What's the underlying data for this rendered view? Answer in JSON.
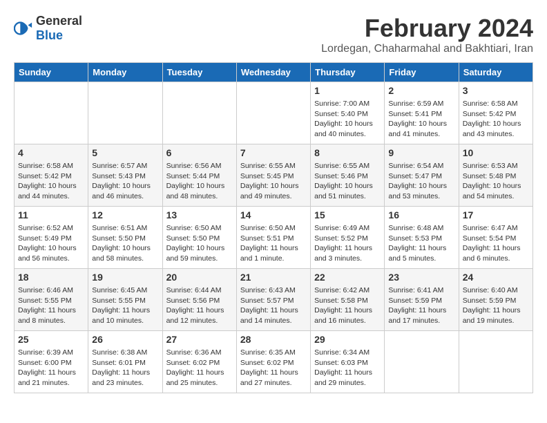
{
  "logo": {
    "general": "General",
    "blue": "Blue"
  },
  "header": {
    "month": "February 2024",
    "location": "Lordegan, Chaharmahal and Bakhtiari, Iran"
  },
  "weekdays": [
    "Sunday",
    "Monday",
    "Tuesday",
    "Wednesday",
    "Thursday",
    "Friday",
    "Saturday"
  ],
  "weeks": [
    [
      {
        "day": "",
        "sunrise": "",
        "sunset": "",
        "daylight": ""
      },
      {
        "day": "",
        "sunrise": "",
        "sunset": "",
        "daylight": ""
      },
      {
        "day": "",
        "sunrise": "",
        "sunset": "",
        "daylight": ""
      },
      {
        "day": "",
        "sunrise": "",
        "sunset": "",
        "daylight": ""
      },
      {
        "day": "1",
        "sunrise": "Sunrise: 7:00 AM",
        "sunset": "Sunset: 5:40 PM",
        "daylight": "Daylight: 10 hours and 40 minutes."
      },
      {
        "day": "2",
        "sunrise": "Sunrise: 6:59 AM",
        "sunset": "Sunset: 5:41 PM",
        "daylight": "Daylight: 10 hours and 41 minutes."
      },
      {
        "day": "3",
        "sunrise": "Sunrise: 6:58 AM",
        "sunset": "Sunset: 5:42 PM",
        "daylight": "Daylight: 10 hours and 43 minutes."
      }
    ],
    [
      {
        "day": "4",
        "sunrise": "Sunrise: 6:58 AM",
        "sunset": "Sunset: 5:42 PM",
        "daylight": "Daylight: 10 hours and 44 minutes."
      },
      {
        "day": "5",
        "sunrise": "Sunrise: 6:57 AM",
        "sunset": "Sunset: 5:43 PM",
        "daylight": "Daylight: 10 hours and 46 minutes."
      },
      {
        "day": "6",
        "sunrise": "Sunrise: 6:56 AM",
        "sunset": "Sunset: 5:44 PM",
        "daylight": "Daylight: 10 hours and 48 minutes."
      },
      {
        "day": "7",
        "sunrise": "Sunrise: 6:55 AM",
        "sunset": "Sunset: 5:45 PM",
        "daylight": "Daylight: 10 hours and 49 minutes."
      },
      {
        "day": "8",
        "sunrise": "Sunrise: 6:55 AM",
        "sunset": "Sunset: 5:46 PM",
        "daylight": "Daylight: 10 hours and 51 minutes."
      },
      {
        "day": "9",
        "sunrise": "Sunrise: 6:54 AM",
        "sunset": "Sunset: 5:47 PM",
        "daylight": "Daylight: 10 hours and 53 minutes."
      },
      {
        "day": "10",
        "sunrise": "Sunrise: 6:53 AM",
        "sunset": "Sunset: 5:48 PM",
        "daylight": "Daylight: 10 hours and 54 minutes."
      }
    ],
    [
      {
        "day": "11",
        "sunrise": "Sunrise: 6:52 AM",
        "sunset": "Sunset: 5:49 PM",
        "daylight": "Daylight: 10 hours and 56 minutes."
      },
      {
        "day": "12",
        "sunrise": "Sunrise: 6:51 AM",
        "sunset": "Sunset: 5:50 PM",
        "daylight": "Daylight: 10 hours and 58 minutes."
      },
      {
        "day": "13",
        "sunrise": "Sunrise: 6:50 AM",
        "sunset": "Sunset: 5:50 PM",
        "daylight": "Daylight: 10 hours and 59 minutes."
      },
      {
        "day": "14",
        "sunrise": "Sunrise: 6:50 AM",
        "sunset": "Sunset: 5:51 PM",
        "daylight": "Daylight: 11 hours and 1 minute."
      },
      {
        "day": "15",
        "sunrise": "Sunrise: 6:49 AM",
        "sunset": "Sunset: 5:52 PM",
        "daylight": "Daylight: 11 hours and 3 minutes."
      },
      {
        "day": "16",
        "sunrise": "Sunrise: 6:48 AM",
        "sunset": "Sunset: 5:53 PM",
        "daylight": "Daylight: 11 hours and 5 minutes."
      },
      {
        "day": "17",
        "sunrise": "Sunrise: 6:47 AM",
        "sunset": "Sunset: 5:54 PM",
        "daylight": "Daylight: 11 hours and 6 minutes."
      }
    ],
    [
      {
        "day": "18",
        "sunrise": "Sunrise: 6:46 AM",
        "sunset": "Sunset: 5:55 PM",
        "daylight": "Daylight: 11 hours and 8 minutes."
      },
      {
        "day": "19",
        "sunrise": "Sunrise: 6:45 AM",
        "sunset": "Sunset: 5:55 PM",
        "daylight": "Daylight: 11 hours and 10 minutes."
      },
      {
        "day": "20",
        "sunrise": "Sunrise: 6:44 AM",
        "sunset": "Sunset: 5:56 PM",
        "daylight": "Daylight: 11 hours and 12 minutes."
      },
      {
        "day": "21",
        "sunrise": "Sunrise: 6:43 AM",
        "sunset": "Sunset: 5:57 PM",
        "daylight": "Daylight: 11 hours and 14 minutes."
      },
      {
        "day": "22",
        "sunrise": "Sunrise: 6:42 AM",
        "sunset": "Sunset: 5:58 PM",
        "daylight": "Daylight: 11 hours and 16 minutes."
      },
      {
        "day": "23",
        "sunrise": "Sunrise: 6:41 AM",
        "sunset": "Sunset: 5:59 PM",
        "daylight": "Daylight: 11 hours and 17 minutes."
      },
      {
        "day": "24",
        "sunrise": "Sunrise: 6:40 AM",
        "sunset": "Sunset: 5:59 PM",
        "daylight": "Daylight: 11 hours and 19 minutes."
      }
    ],
    [
      {
        "day": "25",
        "sunrise": "Sunrise: 6:39 AM",
        "sunset": "Sunset: 6:00 PM",
        "daylight": "Daylight: 11 hours and 21 minutes."
      },
      {
        "day": "26",
        "sunrise": "Sunrise: 6:38 AM",
        "sunset": "Sunset: 6:01 PM",
        "daylight": "Daylight: 11 hours and 23 minutes."
      },
      {
        "day": "27",
        "sunrise": "Sunrise: 6:36 AM",
        "sunset": "Sunset: 6:02 PM",
        "daylight": "Daylight: 11 hours and 25 minutes."
      },
      {
        "day": "28",
        "sunrise": "Sunrise: 6:35 AM",
        "sunset": "Sunset: 6:02 PM",
        "daylight": "Daylight: 11 hours and 27 minutes."
      },
      {
        "day": "29",
        "sunrise": "Sunrise: 6:34 AM",
        "sunset": "Sunset: 6:03 PM",
        "daylight": "Daylight: 11 hours and 29 minutes."
      },
      {
        "day": "",
        "sunrise": "",
        "sunset": "",
        "daylight": ""
      },
      {
        "day": "",
        "sunrise": "",
        "sunset": "",
        "daylight": ""
      }
    ]
  ]
}
